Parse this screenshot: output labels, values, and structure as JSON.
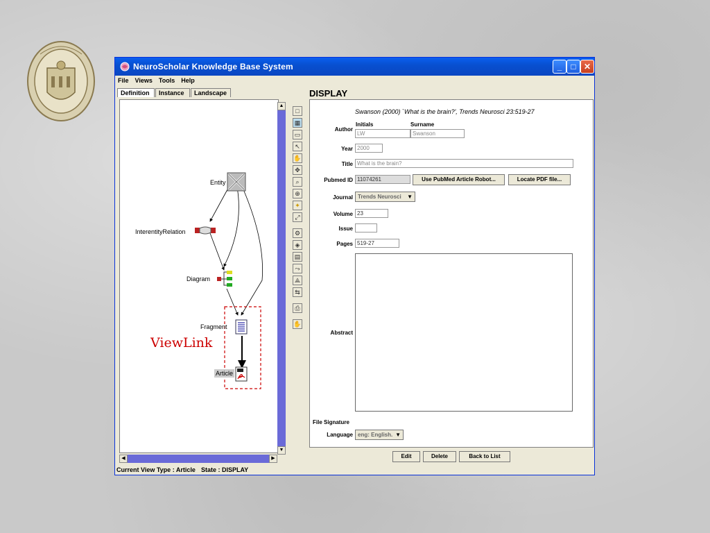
{
  "window": {
    "title": "NeuroScholar Knowledge Base System",
    "accent": "#0a5fef"
  },
  "menu": [
    "File",
    "Views",
    "Tools",
    "Help"
  ],
  "tabs": [
    "Definition",
    "Instance",
    "Landscape"
  ],
  "diagram": {
    "nodes": {
      "entity": "Entity",
      "interentity": "InterentityRelation",
      "diagram": "Diagram",
      "fragment": "Fragment",
      "article": "Article"
    },
    "annotation": "ViewLink",
    "annotation_color": "#cc0000"
  },
  "display": {
    "heading": "DISPLAY",
    "citation": "Swanson (2000) `What is the brain?', Trends Neurosci 23:519-27",
    "author_label": "Author",
    "initials_label": "Initials",
    "surname_label": "Surname",
    "initials_value": "LW",
    "surname_value": "Swanson",
    "year_label": "Year",
    "year_value": "2000",
    "title_label": "Title",
    "title_value": "What is the brain?",
    "pubmed_label": "Pubmed ID",
    "pubmed_value": "11074261",
    "pubmed_robot_btn": "Use PubMed Article Robot...",
    "locate_pdf_btn": "Locate PDF file...",
    "journal_label": "Journal",
    "journal_value": "Trends Neurosci",
    "volume_label": "Volume",
    "volume_value": "23",
    "issue_label": "Issue",
    "issue_value": "",
    "pages_label": "Pages",
    "pages_value": "519-27",
    "abstract_label": "Abstract",
    "file_signature_label": "File Signature",
    "language_label": "Language",
    "language_value": "eng: English."
  },
  "buttons": {
    "edit": "Edit",
    "delete": "Delete",
    "back": "Back to List"
  },
  "status": {
    "view_type": "Current View Type : Article",
    "state": "State : DISPLAY"
  }
}
